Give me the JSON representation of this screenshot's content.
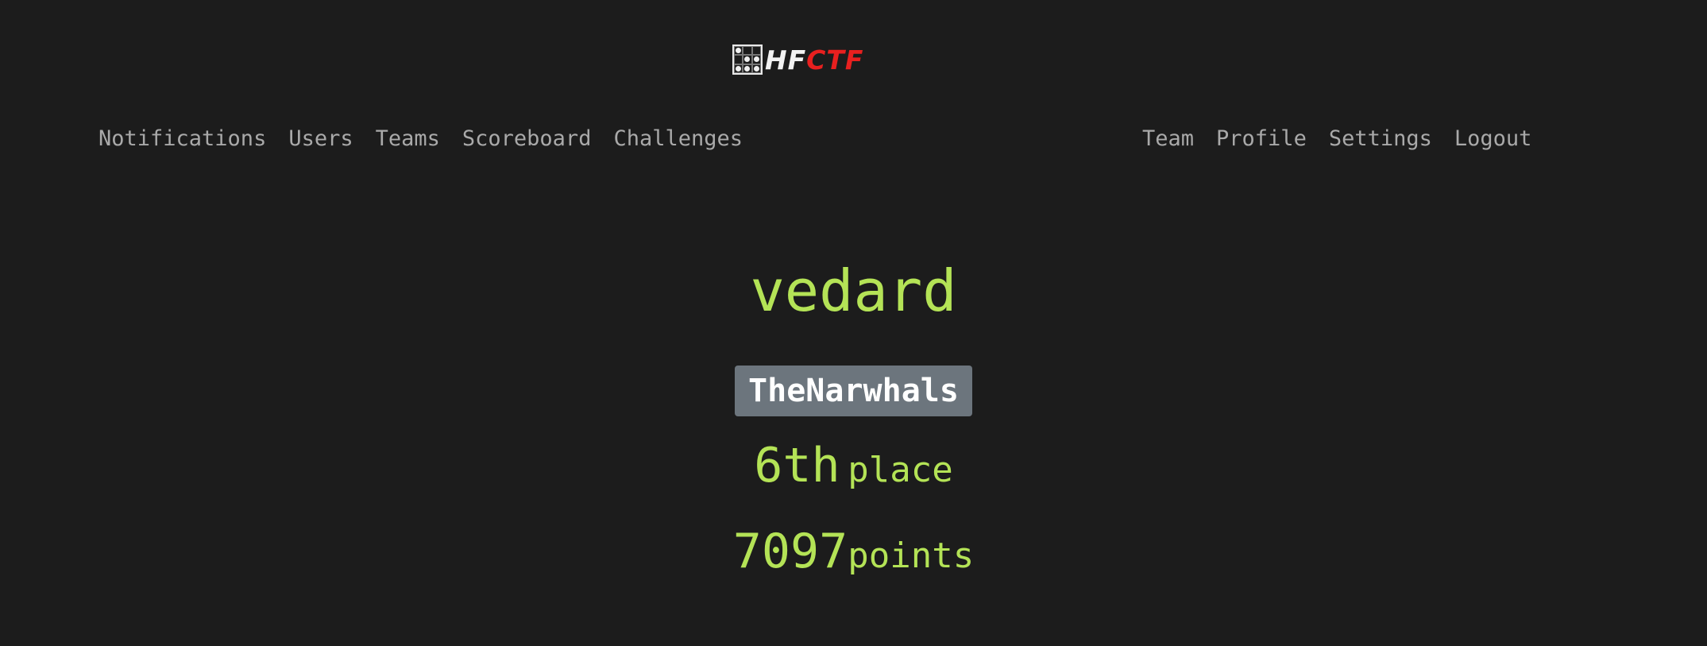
{
  "logo": {
    "text_white": "HF",
    "text_red": "CTF",
    "icon": "logo-grid-icon"
  },
  "nav": {
    "left": [
      {
        "label": "Notifications"
      },
      {
        "label": "Users"
      },
      {
        "label": "Teams"
      },
      {
        "label": "Scoreboard"
      },
      {
        "label": "Challenges"
      }
    ],
    "right": [
      {
        "label": "Team"
      },
      {
        "label": "Profile"
      },
      {
        "label": "Settings"
      },
      {
        "label": "Logout"
      }
    ]
  },
  "profile": {
    "username": "vedard",
    "team": "TheNarwhals",
    "place_value": "6th",
    "place_label": "place",
    "points_value": "7097",
    "points_label": "points"
  },
  "colors": {
    "background": "#1c1c1c",
    "accent": "#b4e356",
    "nav_text": "#a9a9a9",
    "badge": "#6c757d",
    "logo_red": "#e8201f"
  }
}
